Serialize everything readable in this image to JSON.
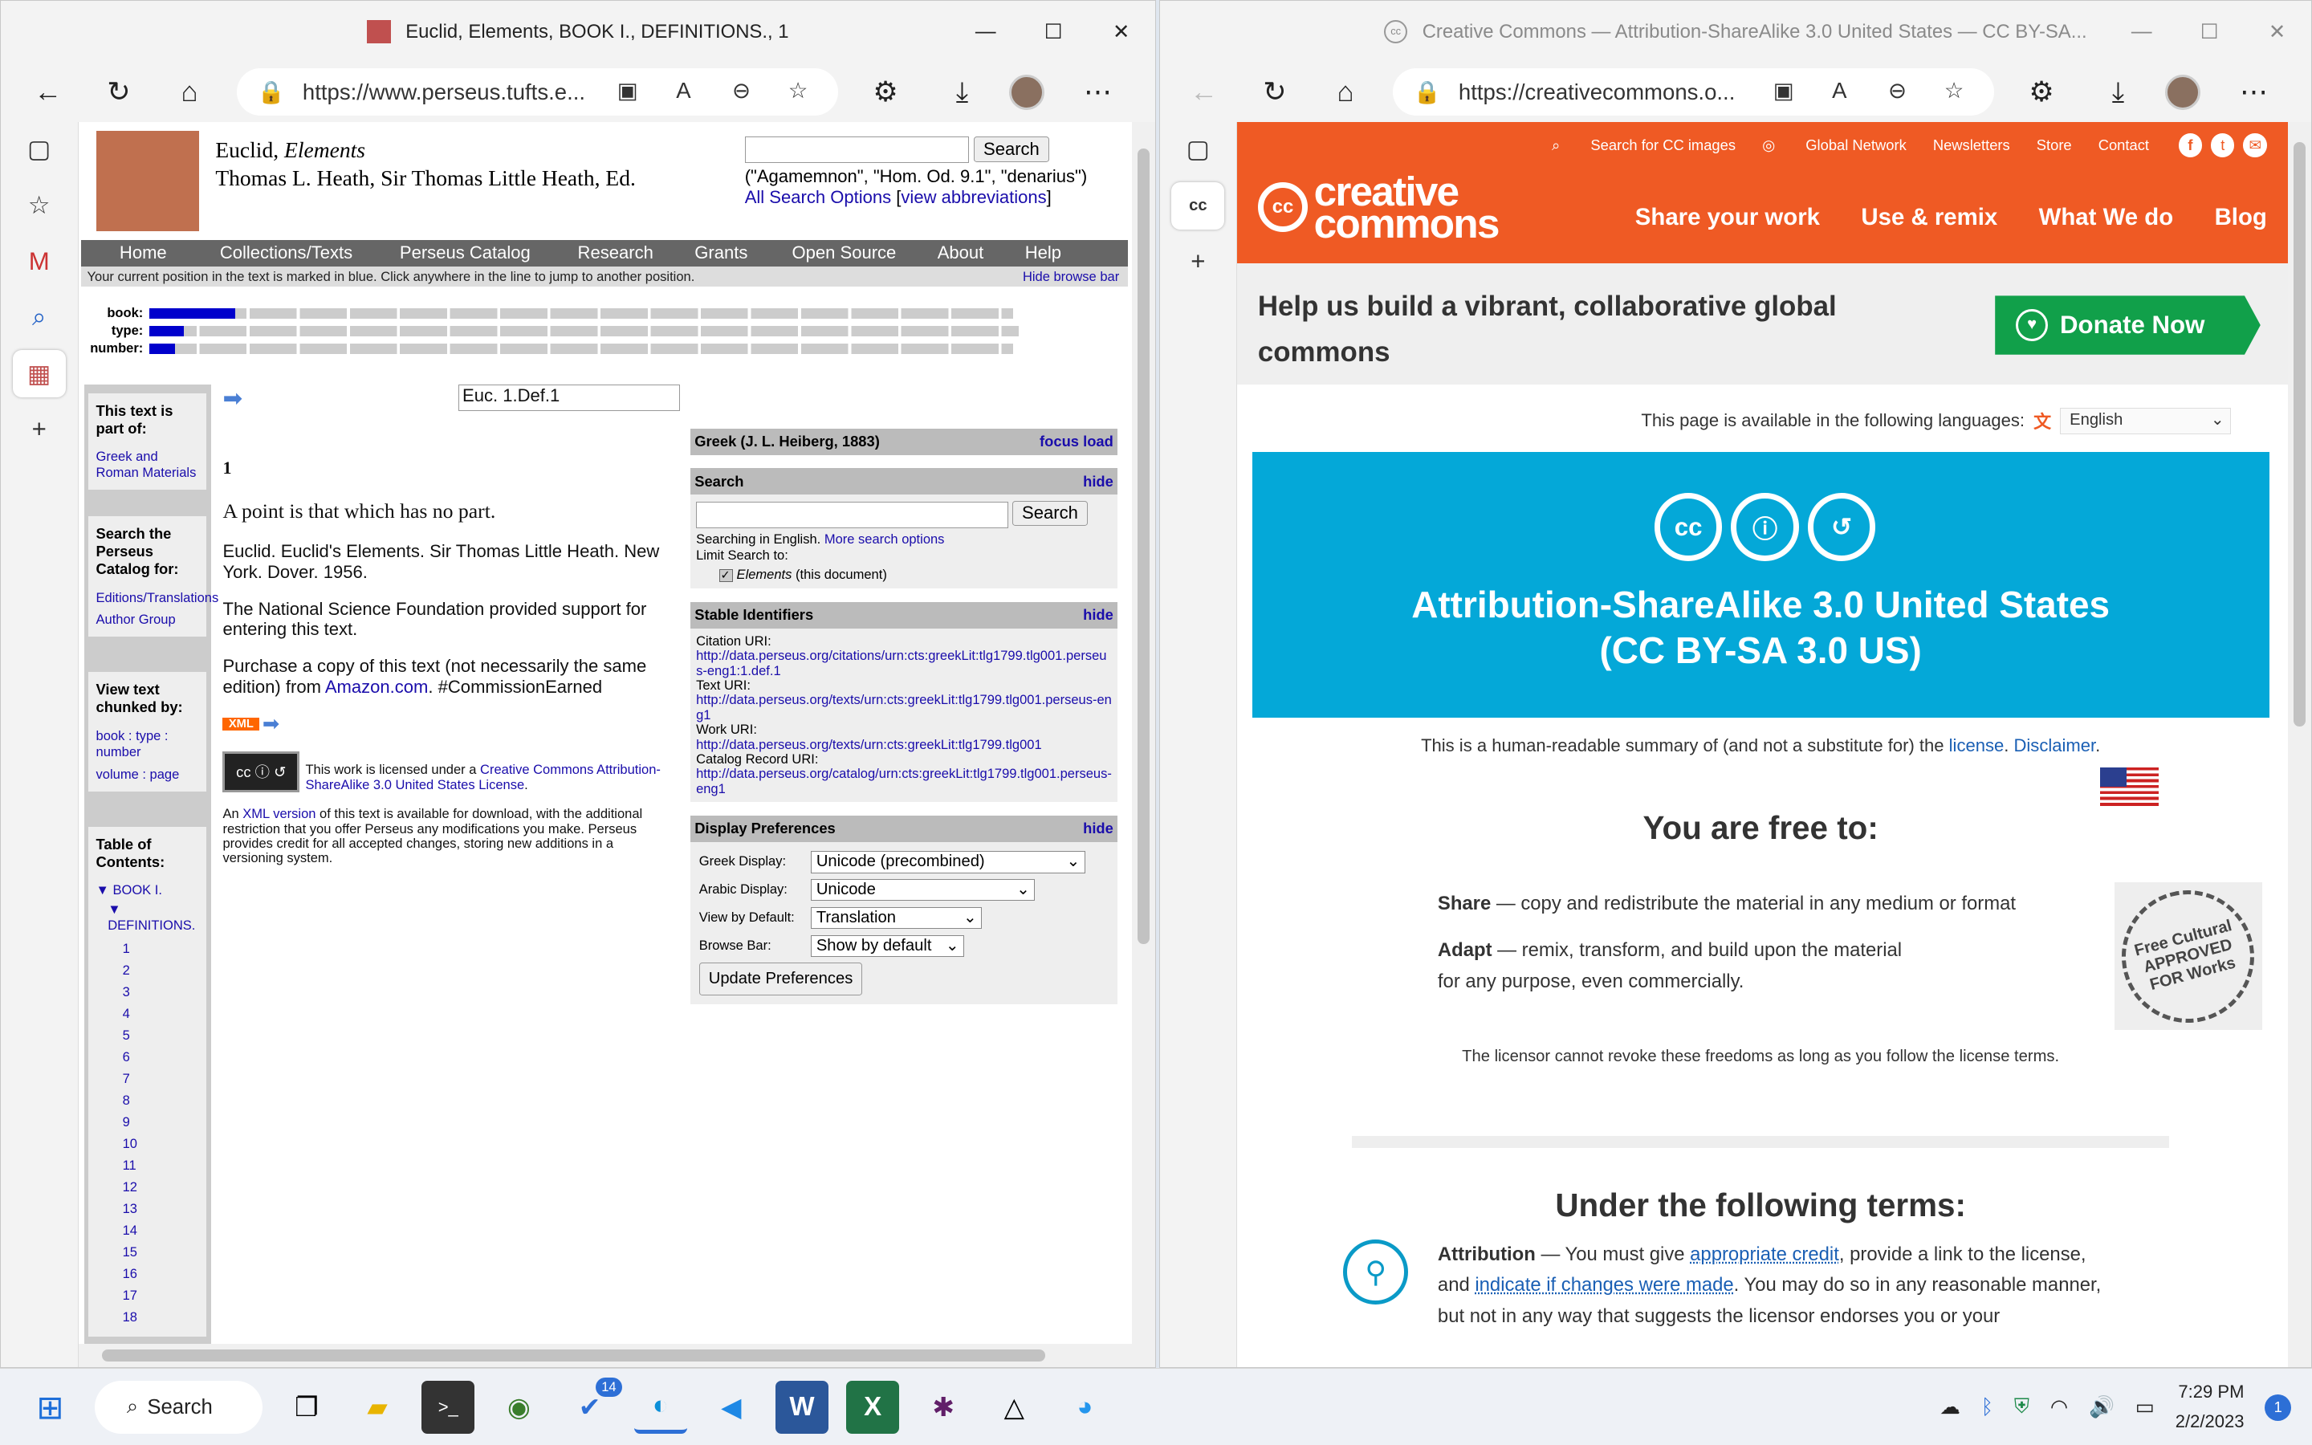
{
  "left_window": {
    "title": "Euclid, Elements, BOOK I., DEFINITIONS., 1",
    "url": "https://www.perseus.tufts.e...",
    "page": {
      "author_line": "Euclid, ",
      "work_title": "Elements",
      "editor_line": "Thomas L. Heath, Sir Thomas Little Heath, Ed.",
      "search_button": "Search",
      "search_examples": "(\"Agamemnon\", \"Hom. Od. 9.1\", \"denarius\")",
      "all_search_options": "All Search Options",
      "view_abbreviations": "view abbreviations",
      "nav": [
        "Home",
        "Collections/Texts",
        "Perseus Catalog",
        "Research",
        "Grants",
        "Open Source",
        "About",
        "Help"
      ],
      "position_note": "Your current position in the text is marked in blue. Click anywhere in the line to jump to another position.",
      "hide_browse_bar": "Hide browse bar",
      "bar_labels": {
        "book": "book:",
        "type": "type:",
        "number": "number:"
      },
      "bar_progress": {
        "book": 0.1,
        "type": 0.04,
        "number": 0.03
      },
      "left_boxes": {
        "part_of_title": "This text is part of:",
        "part_of_link": "Greek and Roman Materials",
        "catalog_title": "Search the Perseus Catalog for:",
        "catalog_links": [
          "Editions/Translations",
          "Author Group"
        ],
        "chunk_title": "View text chunked by:",
        "chunk_line1": "book : type : number",
        "chunk_line2": "volume : page",
        "toc_title": "Table of Contents:",
        "toc_book": "BOOK I.",
        "toc_defs": "DEFINITIONS.",
        "toc_numbers": [
          "1",
          "2",
          "3",
          "4",
          "5",
          "6",
          "7",
          "8",
          "9",
          "10",
          "11",
          "12",
          "13",
          "14",
          "15",
          "16",
          "17",
          "18"
        ]
      },
      "main": {
        "locator": "Euc. 1.Def.1",
        "section_num": "1",
        "definition": "A point is that which has no part.",
        "citation": "Euclid. Euclid's Elements. Sir Thomas Little Heath. New York. Dover. 1956.",
        "nsf": "The National Science Foundation provided support for entering this text.",
        "purchase_prefix": "Purchase a copy of this text (not necessarily the same edition) from ",
        "amazon": "Amazon.com",
        "purchase_suffix": ". #CommissionEarned",
        "xml_badge": "XML",
        "license_prefix": "This work is licensed under a ",
        "license_link": "Creative Commons Attribution-ShareAlike 3.0 United States License",
        "xml_prefix": "An ",
        "xml_link": "XML version",
        "xml_suffix": " of this text is available for download, with the additional restriction that you offer Perseus any modifications you make. Perseus provides credit for all accepted changes, storing new additions in a versioning system."
      },
      "right": {
        "greek_title": "Greek (J. L. Heiberg, 1883)",
        "focus_load": "focus load",
        "search_title": "Search",
        "hide": "hide",
        "search_button": "Search",
        "searching_in": "Searching in English. ",
        "more_options": "More search options",
        "limit": "Limit Search to:",
        "elements": "Elements",
        "this_doc": " (this document)",
        "stable_title": "Stable Identifiers",
        "citation_uri_label": "Citation URI:",
        "citation_uri": "http://data.perseus.org/citations/urn:cts:greekLit:tlg1799.tlg001.perseus-eng1:1.def.1",
        "text_uri_label": "Text URI:",
        "text_uri": "http://data.perseus.org/texts/urn:cts:greekLit:tlg1799.tlg001.perseus-eng1",
        "work_uri_label": "Work URI:",
        "work_uri": "http://data.perseus.org/texts/urn:cts:greekLit:tlg1799.tlg001",
        "catalog_uri_label": "Catalog Record URI:",
        "catalog_uri": "http://data.perseus.org/catalog/urn:cts:greekLit:tlg1799.tlg001.perseus-eng1",
        "display_title": "Display Preferences",
        "greek_display_label": "Greek Display:",
        "greek_display": "Unicode (precombined)",
        "arabic_display_label": "Arabic Display:",
        "arabic_display": "Unicode",
        "view_default_label": "View by Default:",
        "view_default": "Translation",
        "browse_bar_label": "Browse Bar:",
        "browse_bar": "Show by default",
        "update": "Update Preferences"
      }
    }
  },
  "right_window": {
    "title": "Creative Commons — Attribution-ShareAlike 3.0 United States — CC BY-SA...",
    "url": "https://creativecommons.o...",
    "page": {
      "util_links": [
        "Search for CC images",
        "Global Network",
        "Newsletters",
        "Store",
        "Contact"
      ],
      "logo_text": "creative commons",
      "menu": [
        "Share your work",
        "Use & remix",
        "What We do",
        "Blog"
      ],
      "donate_headline": "Help us build a vibrant, collaborative global commons",
      "donate_button": "Donate Now",
      "lang_prompt": "This page is available in the following languages:",
      "lang_value": "English",
      "license_title_1": "Attribution-ShareAlike 3.0 United States",
      "license_title_2": "(CC BY-SA 3.0 US)",
      "summary_prefix": "This is a human-readable summary of (and not a substitute for) the ",
      "summary_license": "license",
      "summary_disclaimer": "Disclaimer",
      "free_heading": "You are free to:",
      "share_term": "Share",
      "share_text": " — copy and redistribute the material in any medium or format",
      "adapt_term": "Adapt",
      "adapt_text": " — remix, transform, and build upon the material",
      "adapt_text2": "for any purpose, even commercially.",
      "stamp_text": "Free Cultural APPROVED FOR Works",
      "revoke_text": "The licensor cannot revoke these freedoms as long as you follow the license terms.",
      "terms_heading": "Under the following terms:",
      "attr_term": "Attribution",
      "attr_1": " — You must give ",
      "attr_link1": "appropriate credit",
      "attr_2": ", provide a link to the license, and ",
      "attr_link2": "indicate if changes were made",
      "attr_3": ". You may do so in any reasonable manner, but not in any way that suggests the licensor endorses you or your"
    }
  },
  "taskbar": {
    "search_label": "Search",
    "badge_count": "14",
    "time": "7:29 PM",
    "date": "2/2/2023",
    "notification_count": "1"
  }
}
